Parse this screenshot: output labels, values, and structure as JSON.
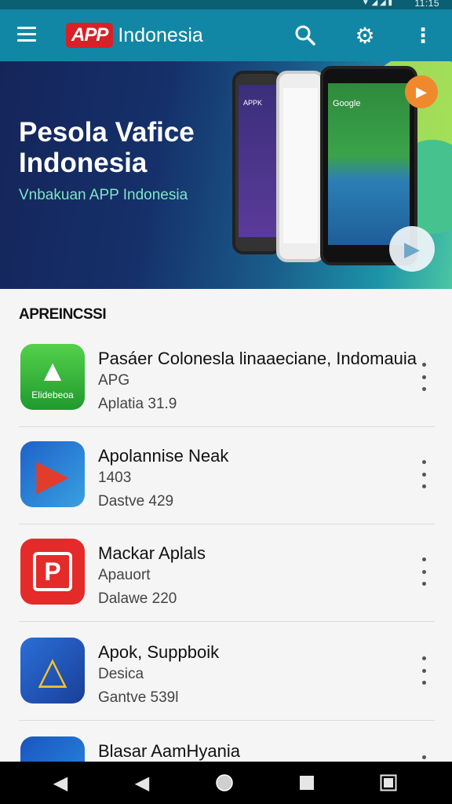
{
  "status_bar": {
    "time": "11:15",
    "icons": "▼ ◢ ◢ ▮"
  },
  "app_bar": {
    "brand_badge": "APP",
    "brand_name": "Indonesia"
  },
  "hero": {
    "title": "Pesola Vafice Indonesia",
    "subtitle": "Vnbakuan APP Indonesia",
    "phone_left_label": "APPK",
    "phone_right_label": "Google"
  },
  "section": {
    "title": "APREINCSSI"
  },
  "apps": [
    {
      "title": "Pasáer Colonesla linaaeciane, Indomauia",
      "line2": "APG",
      "line3": "Aplatia 31.9",
      "icon_label": "Elidebeoa",
      "icon": "green-triangle-icon"
    },
    {
      "title": "Apolannise Neak",
      "line2": "1403",
      "line3": "Dastve 429",
      "icon": "play-store-icon"
    },
    {
      "title": "Mackar Aplals",
      "line2": "Apauort",
      "line3": "Dalawe 220",
      "icon": "red-p-icon"
    },
    {
      "title": "Apok, Suppboik",
      "line2": "Desica",
      "line3": "Gantve 539l",
      "icon": "drive-triangle-icon"
    },
    {
      "title": "Blasar AamHyania",
      "line2": "",
      "line3": "",
      "icon": "blue-folder-icon"
    }
  ],
  "colors": {
    "app_bar": "#1187a5",
    "status_bar": "#0b5f73",
    "brand_red": "#d92027",
    "accent_green": "#7fe6c6"
  }
}
